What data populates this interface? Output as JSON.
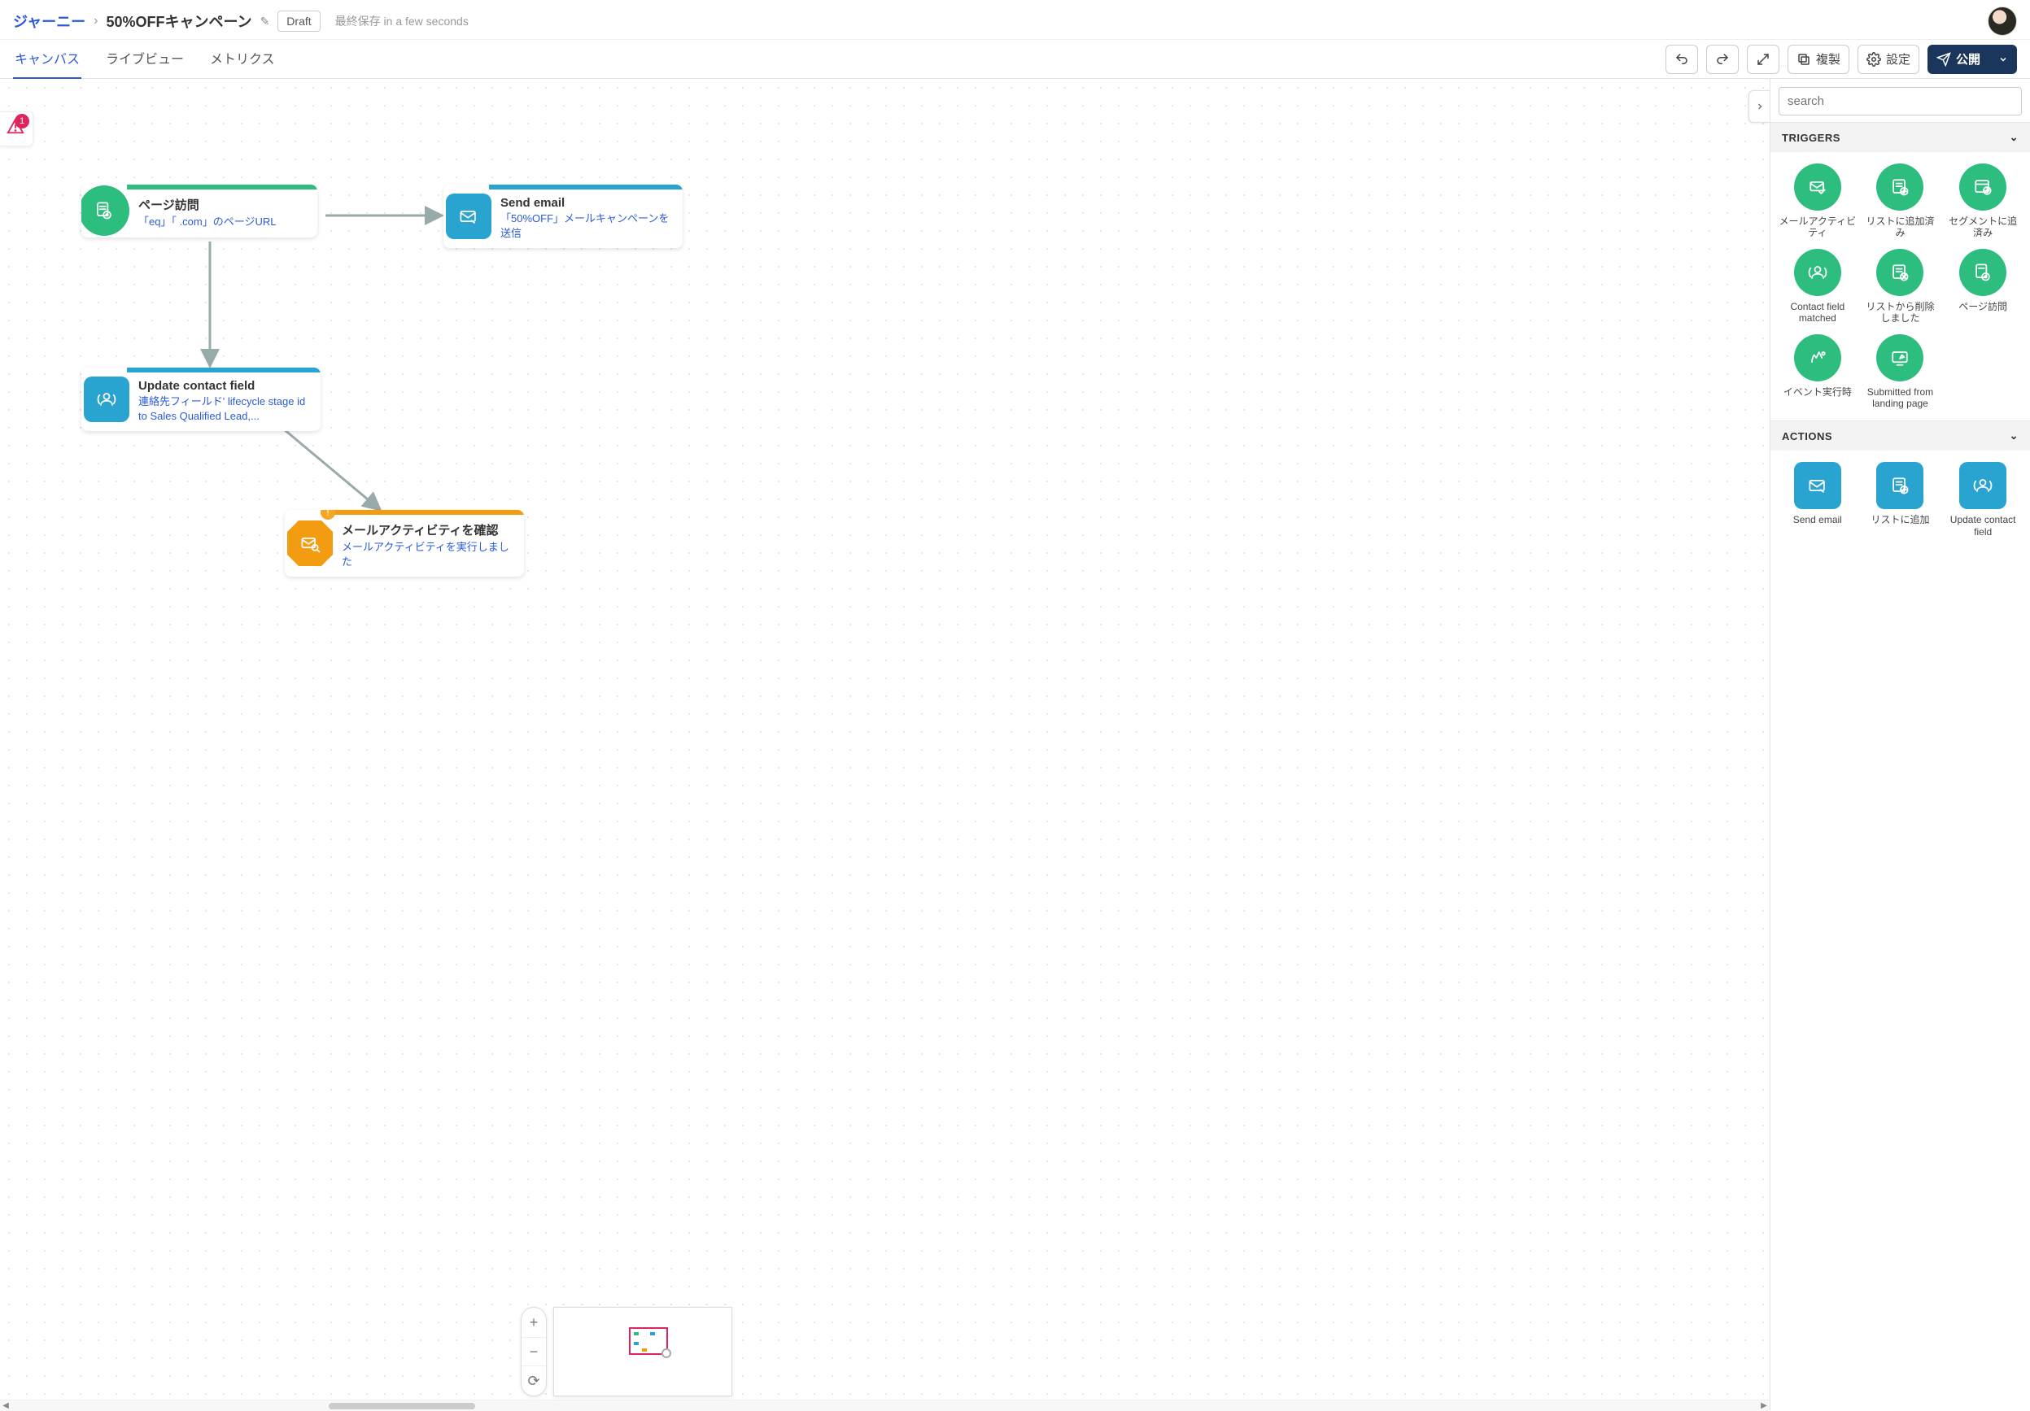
{
  "header": {
    "breadcrumb_root": "ジャーニー",
    "separator": "›",
    "title": "50%OFFキャンペーン",
    "status_badge": "Draft",
    "last_saved_prefix": "最終保存",
    "last_saved_value": "in a few seconds"
  },
  "tabs": {
    "canvas": "キャンバス",
    "live": "ライブビュー",
    "metrics": "メトリクス",
    "active": "canvas"
  },
  "toolbar": {
    "duplicate": "複製",
    "settings": "設定",
    "publish": "公開"
  },
  "error_flag": {
    "count": "1"
  },
  "nodes": {
    "n1": {
      "title": "ページ訪問",
      "desc": "「eq」「                        .com」のページURL"
    },
    "n2": {
      "title": "Send email",
      "desc": "「50%OFF」メールキャンペーンを送信"
    },
    "n3": {
      "title": "Update contact field",
      "desc": "連絡先フィールド' lifecycle stage id to Sales Qualified Lead,..."
    },
    "n4": {
      "title": "メールアクティビティを確認",
      "desc": "メールアクティビティを実行しました"
    }
  },
  "sidebar": {
    "search_placeholder": "search",
    "sections": {
      "triggers": {
        "title": "TRIGGERS"
      },
      "actions": {
        "title": "ACTIONS"
      }
    },
    "triggers": [
      {
        "label": "メールアクティビティ"
      },
      {
        "label": "リストに追加済み"
      },
      {
        "label": "セグメントに追済み"
      },
      {
        "label": "Contact field matched"
      },
      {
        "label": "リストから削除しました"
      },
      {
        "label": "ページ訪問"
      },
      {
        "label": "イベント実行時"
      },
      {
        "label": "Submitted from landing page"
      }
    ],
    "actions": [
      {
        "label": "Send email"
      },
      {
        "label": "リストに追加"
      },
      {
        "label": "Update contact field"
      }
    ]
  },
  "zoom": {
    "plus": "+",
    "minus": "−",
    "reset": "⟳"
  }
}
